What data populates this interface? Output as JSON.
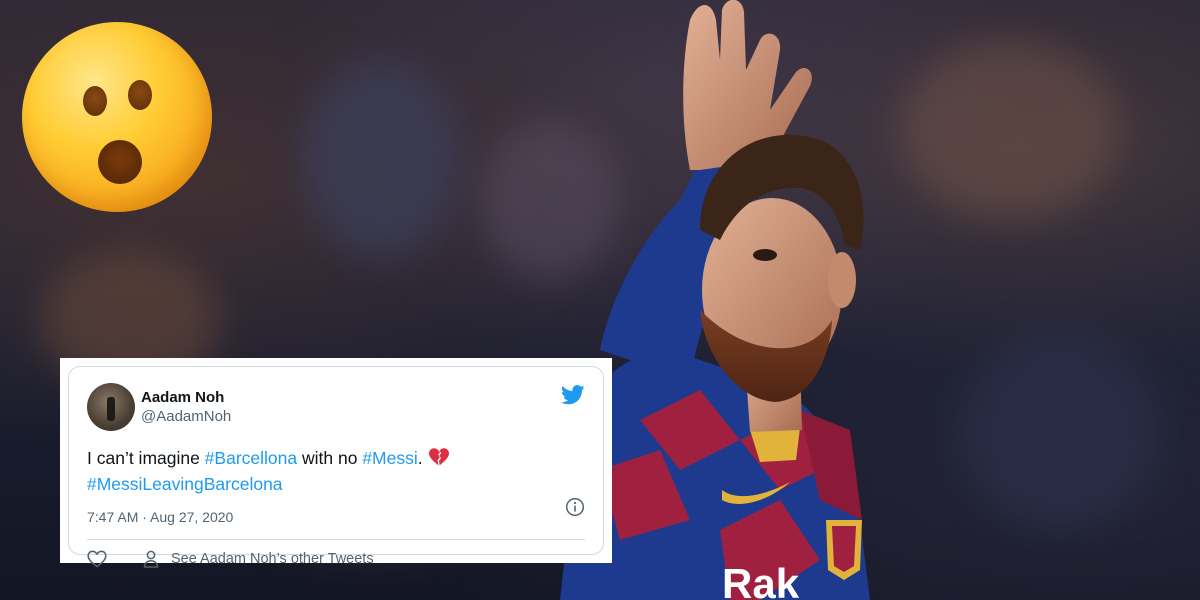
{
  "tweet": {
    "display_name": "Aadam Noh",
    "handle": "@AadamNoh",
    "text_prefix": "I can’t imagine ",
    "tag_1": "#Barcellona",
    "text_middle": " with no ",
    "tag_2": "#Messi",
    "text_suffix": ".",
    "tag_3": "#MessiLeavingBarcelona",
    "timestamp": "7:47 AM · Aug 27, 2020",
    "see_more_label": "See Aadam Noh’s other Tweets"
  },
  "icons": {
    "emoji": "hushed-face-emoji",
    "twitter": "twitter-bird-icon",
    "broken_heart": "broken-heart-emoji",
    "info": "info-icon",
    "like": "heart-icon",
    "profile": "person-icon"
  },
  "colors": {
    "link": "#1d9bf0",
    "text": "#0f1419",
    "muted": "#536471",
    "border": "#cfd9de",
    "barca_blue": "#1e3a8f",
    "barca_red": "#a0203f"
  },
  "shirt_text": "Rak"
}
